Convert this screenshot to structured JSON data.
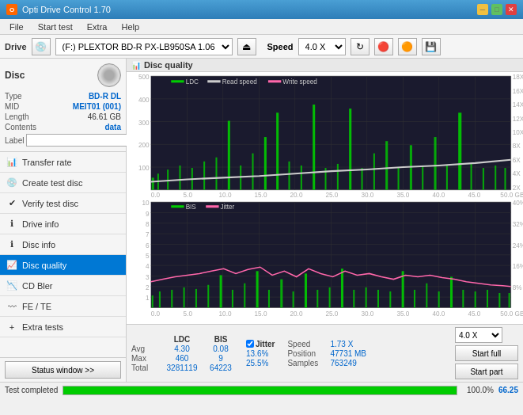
{
  "titlebar": {
    "title": "Opti Drive Control 1.70",
    "icon_label": "O"
  },
  "menubar": {
    "items": [
      "File",
      "Start test",
      "Extra",
      "Help"
    ]
  },
  "toolbar": {
    "drive_label": "Drive",
    "drive_value": "(F:)  PLEXTOR BD-R  PX-LB950SA 1.06",
    "speed_label": "Speed",
    "speed_value": "4.0 X"
  },
  "sidebar": {
    "disc_title": "Disc",
    "disc_fields": [
      {
        "label": "Type",
        "value": "BD-R DL",
        "color": "blue"
      },
      {
        "label": "MID",
        "value": "MEIT01 (001)",
        "color": "blue"
      },
      {
        "label": "Length",
        "value": "46.61 GB",
        "color": "black"
      },
      {
        "label": "Contents",
        "value": "data",
        "color": "blue"
      },
      {
        "label": "Label",
        "value": "",
        "color": "input"
      }
    ],
    "nav_items": [
      {
        "label": "Transfer rate",
        "active": false
      },
      {
        "label": "Create test disc",
        "active": false
      },
      {
        "label": "Verify test disc",
        "active": false
      },
      {
        "label": "Drive info",
        "active": false
      },
      {
        "label": "Disc info",
        "active": false
      },
      {
        "label": "Disc quality",
        "active": true
      },
      {
        "label": "CD Bler",
        "active": false
      },
      {
        "label": "FE / TE",
        "active": false
      },
      {
        "label": "Extra tests",
        "active": false
      }
    ]
  },
  "chart": {
    "title": "Disc quality",
    "legend_ldc": "LDC",
    "legend_read": "Read speed",
    "legend_write": "Write speed",
    "legend_bis": "BIS",
    "legend_jitter": "Jitter",
    "ldc_color": "#00aa00",
    "read_color": "#cccccc",
    "write_color": "#ff66aa",
    "bis_color": "#00aa00",
    "jitter_color": "#ff66aa",
    "y_max_top": 500,
    "y_max_right": 18,
    "y_max_bottom": 10,
    "y_max_right2": 40
  },
  "stats": {
    "col_headers": [
      "LDC",
      "BIS",
      "",
      "Jitter",
      "Speed",
      ""
    ],
    "avg_ldc": "4.30",
    "avg_bis": "0.08",
    "avg_jitter": "13.6%",
    "max_ldc": "460",
    "max_bis": "9",
    "max_jitter": "25.5%",
    "total_ldc": "3281119",
    "total_bis": "64223",
    "speed_label": "Speed",
    "speed_val": "1.73 X",
    "position_label": "Position",
    "position_val": "47731 MB",
    "samples_label": "Samples",
    "samples_val": "763249",
    "speed_select": "4.0 X",
    "btn_start_full": "Start full",
    "btn_start_part": "Start part"
  },
  "statusbar": {
    "text": "Test completed",
    "progress": 100,
    "progress_text": "100.0%",
    "value": "66.25"
  }
}
